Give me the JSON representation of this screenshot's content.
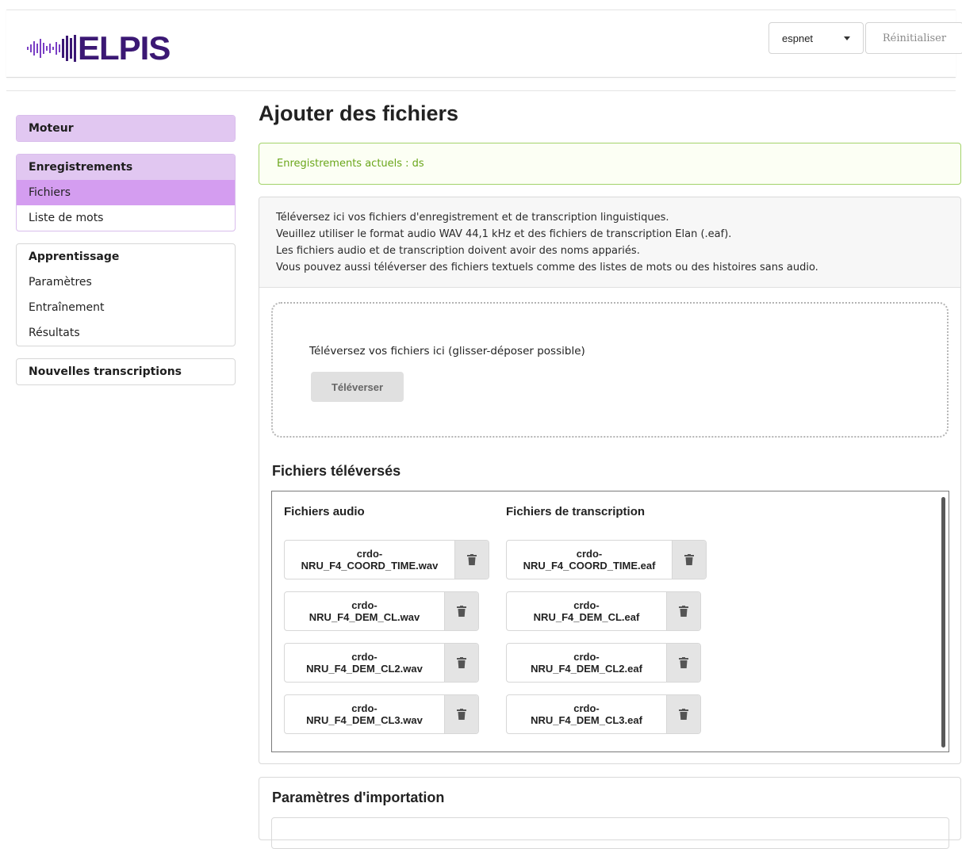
{
  "app": {
    "logo_text": "ELPIS"
  },
  "header": {
    "engine_value": "espnet",
    "reset_label": "Réinitialiser"
  },
  "sidebar": {
    "groups": [
      {
        "title": "Moteur",
        "items": []
      },
      {
        "title": "Enregistrements",
        "items": [
          "Fichiers",
          "Liste de mots"
        ]
      },
      {
        "title": "Apprentissage",
        "items": [
          "Paramètres",
          "Entraînement",
          "Résultats"
        ]
      },
      {
        "title": "Nouvelles transcriptions",
        "items": []
      }
    ],
    "active_item": "Fichiers"
  },
  "main": {
    "title": "Ajouter des fichiers",
    "alert": "Enregistrements actuels : ds",
    "instructions": [
      "Téléversez ici vos fichiers d'enregistrement et de transcription linguistiques.",
      "Veuillez utiliser le format audio WAV 44,1 kHz et des fichiers de transcription Elan (.eaf).",
      "Les fichiers audio et de transcription doivent avoir des noms appariés.",
      "Vous pouvez aussi téléverser des fichiers textuels comme des listes de mots ou des histoires sans audio."
    ],
    "dropzone_label": "Téléversez vos fichiers ici (glisser-déposer possible)",
    "upload_button": "Téléverser",
    "uploaded_title": "Fichiers téléversés",
    "audio_header": "Fichiers audio",
    "transcription_header": "Fichiers de transcription",
    "audio_files": [
      {
        "line1": "crdo-",
        "line2": "NRU_F4_COORD_TIME.wav"
      },
      {
        "line1": "crdo-",
        "line2": "NRU_F4_DEM_CL.wav"
      },
      {
        "line1": "crdo-",
        "line2": "NRU_F4_DEM_CL2.wav"
      },
      {
        "line1": "crdo-",
        "line2": "NRU_F4_DEM_CL3.wav"
      }
    ],
    "transcription_files": [
      {
        "line1": "crdo-",
        "line2": "NRU_F4_COORD_TIME.eaf"
      },
      {
        "line1": "crdo-",
        "line2": "NRU_F4_DEM_CL.eaf"
      },
      {
        "line1": "crdo-",
        "line2": "NRU_F4_DEM_CL2.eaf"
      },
      {
        "line1": "crdo-",
        "line2": "NRU_F4_DEM_CL3.eaf"
      }
    ],
    "delete_icon": "trash-icon",
    "import_title": "Paramètres d'importation"
  },
  "colors": {
    "brand": "#3b1874",
    "nav_highlight": "#e1c7f1",
    "nav_active": "#d49df0",
    "alert_border": "#a3d36b",
    "alert_text": "#6aa61b"
  }
}
